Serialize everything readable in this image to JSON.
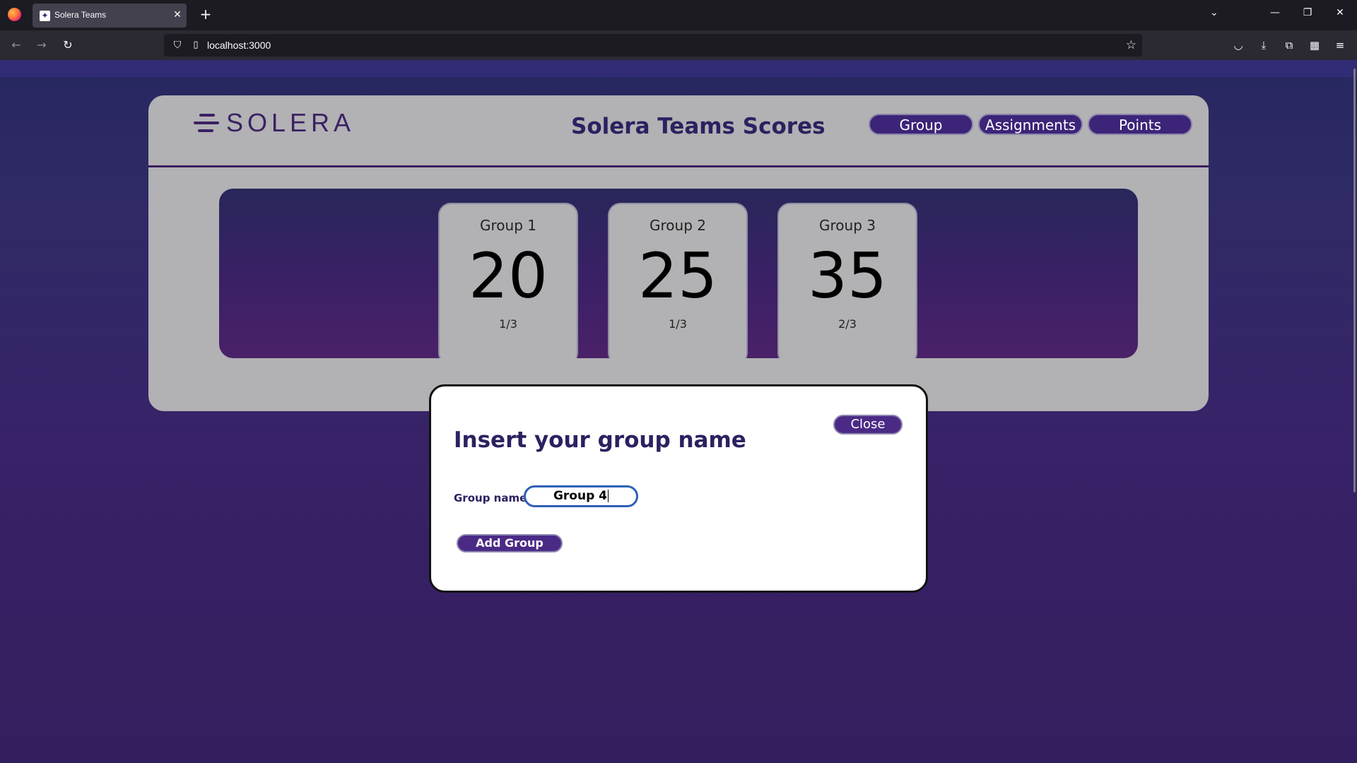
{
  "browser": {
    "tab_title": "Solera Teams",
    "url": "localhost:3000"
  },
  "header": {
    "logo_text": "SOLERA",
    "title": "Solera Teams Scores",
    "nav": [
      {
        "label": "Group"
      },
      {
        "label": "Assignments"
      },
      {
        "label": "Points"
      }
    ]
  },
  "groups": [
    {
      "name": "Group 1",
      "score": "20",
      "sub": "1/3"
    },
    {
      "name": "Group 2",
      "score": "25",
      "sub": "1/3"
    },
    {
      "name": "Group 3",
      "score": "35",
      "sub": "2/3"
    }
  ],
  "modal": {
    "close_label": "Close",
    "title": "Insert your group name",
    "field_label": "Group name:",
    "field_value": "Group 4",
    "submit_label": "Add Group"
  },
  "colors": {
    "brand_purple": "#3c2478",
    "page_bg": "#2f2458",
    "card_gray": "#b2b1b4",
    "title_navy": "#2a2260",
    "input_focus": "#2e5fb7"
  }
}
